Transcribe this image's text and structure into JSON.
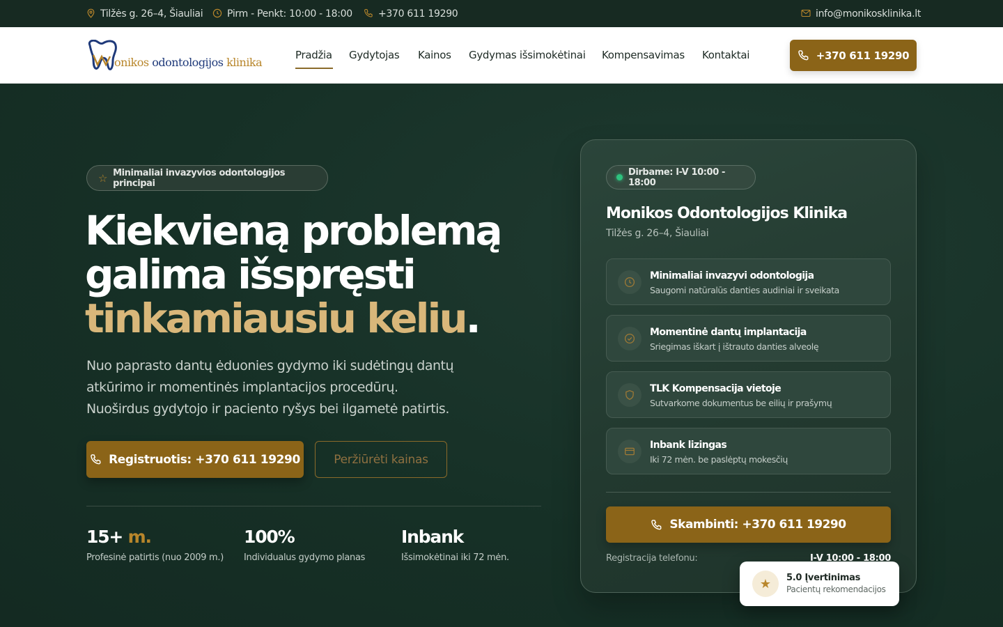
{
  "topbar": {
    "address": "Tilžės g. 26–4, Šiauliai",
    "hours": "Pirm - Penkt: 10:00 - 18:00",
    "phone": "+370 611 19290",
    "email": "info@monikosklinika.lt"
  },
  "nav": {
    "logo": {
      "part1": "onikos",
      "part2": "odontologijos",
      "part3": "klinika"
    },
    "items": [
      {
        "label": "Pradžia",
        "active": true
      },
      {
        "label": "Gydytojas"
      },
      {
        "label": "Kainos"
      },
      {
        "label": "Gydymas išsimokėtinai"
      },
      {
        "label": "Kompensavimas"
      },
      {
        "label": "Kontaktai"
      }
    ],
    "cta_label": "+370 611 19290"
  },
  "hero": {
    "badge": "Minimaliai invazyvios odontologijos principai",
    "title_line1": "Kiekvieną problemą",
    "title_line2": "galima išspręsti",
    "title_line3": "tinkamiausiu keliu",
    "title_dot": ".",
    "lead": "Nuo paprasto dantų ėduonies gydymo iki sudėtingų dantų atkūrimo ir momentinės implantacijos procedūrų. Nuoširdus gydytojo ir paciento ryšys bei ilgametė patirtis.",
    "primary_button": "Registruotis: +370 611 19290",
    "secondary_button": "Peržiūrėti kainas",
    "stats": [
      {
        "value": "15+",
        "unit": "m.",
        "label": "Profesinė patirtis (nuo 2009 m.)"
      },
      {
        "value": "100%",
        "unit": "",
        "label": "Individualus gydymo planas"
      },
      {
        "value": "Inbank",
        "unit": "",
        "label": "Išsimokėtinai iki 72 mėn."
      }
    ]
  },
  "card": {
    "status": "Dirbame: I-V 10:00 - 18:00",
    "title": "Monikos Odontologijos Klinika",
    "address": "Tilžės g. 26–4, Šiauliai",
    "features": [
      {
        "icon": "clock-icon",
        "title": "Minimaliai invazyvi odontologija",
        "subtitle": "Saugomi natūralūs danties audiniai ir sveikata"
      },
      {
        "icon": "check-circle-icon",
        "title": "Momentinė dantų implantacija",
        "subtitle": "Sriegimas iškart į ištrauto danties alveolę"
      },
      {
        "icon": "shield-icon",
        "title": "TLK Kompensacija vietoje",
        "subtitle": "Sutvarkome dokumentus be eilių ir prašymų"
      },
      {
        "icon": "card-icon",
        "title": "Inbank lizingas",
        "subtitle": "Iki 72 mėn. be paslėptų mokesčių"
      }
    ],
    "cta": "Skambinti: +370 611 19290",
    "reg_label": "Registracija telefonu:",
    "reg_hours": "I-V 10:00 - 18:00"
  },
  "rating": {
    "title": "5.0 Įvertinimas",
    "subtitle": "Pacientų rekomendacijos"
  }
}
